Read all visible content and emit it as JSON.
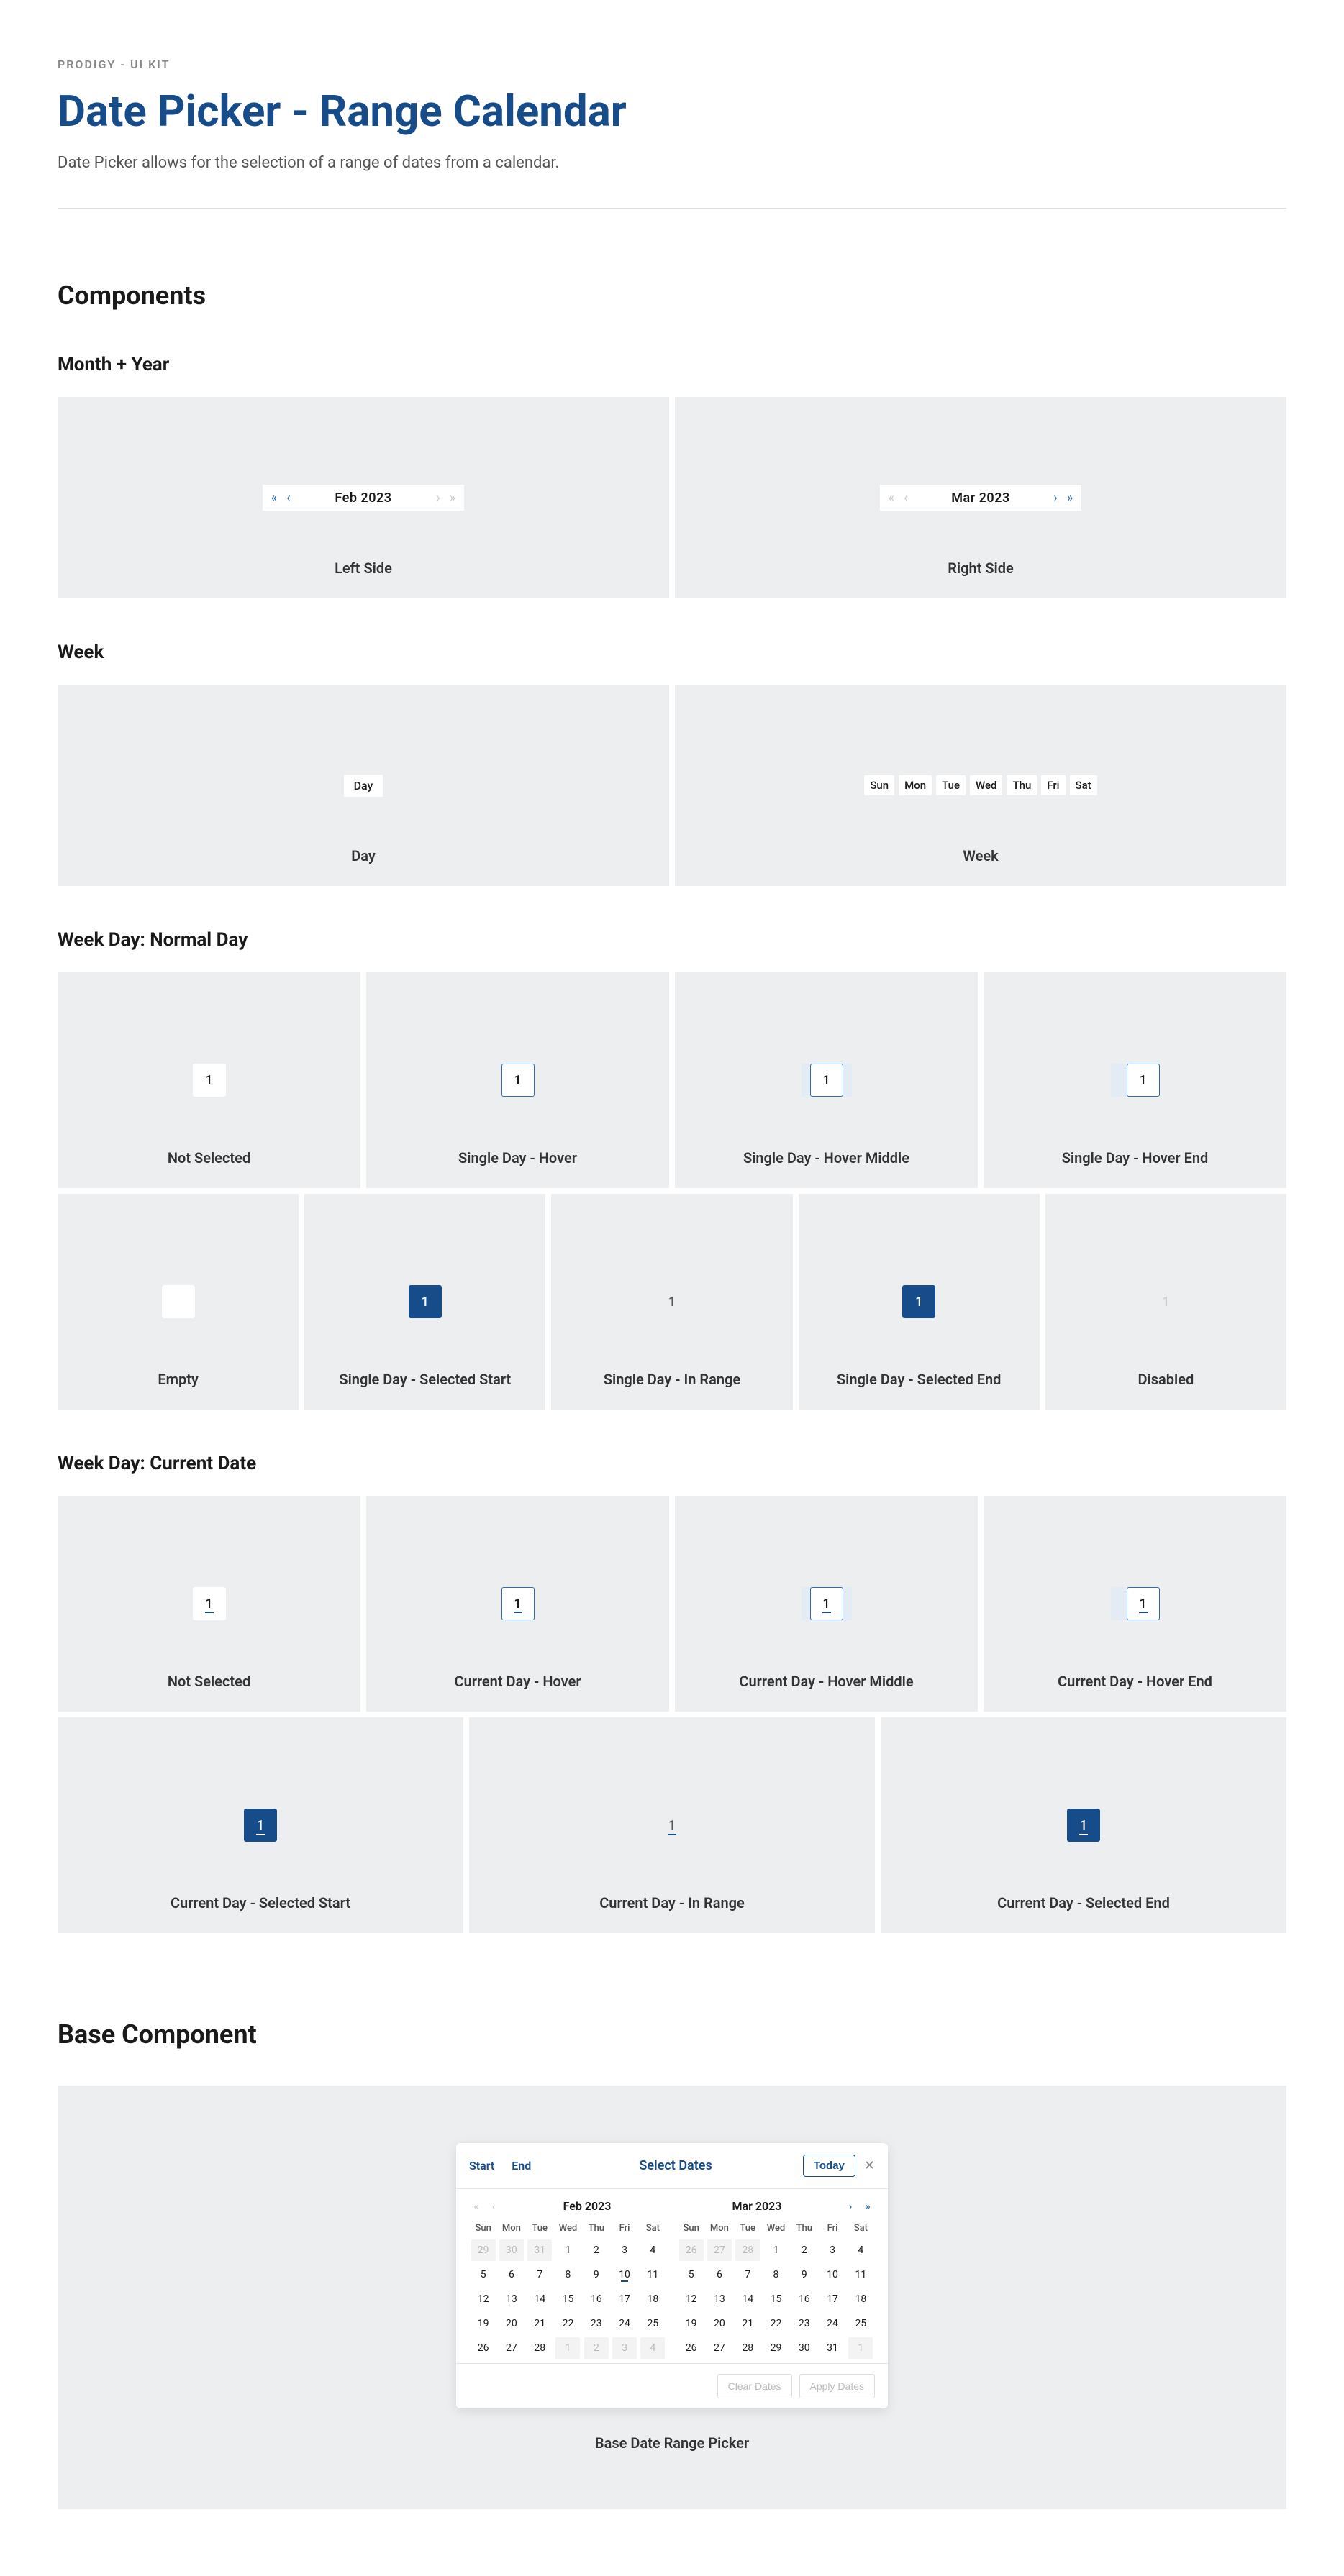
{
  "eyebrow": "PRODIGY - UI KIT",
  "title": "Date Picker - Range Calendar",
  "description": "Date Picker allows for the selection of a range of dates from a calendar.",
  "sections": {
    "components": "Components",
    "monthYear": "Month +  Year",
    "week": "Week",
    "normalDay": "Week Day: Normal Day",
    "currentDate": "Week Day: Current Date",
    "baseComponent": "Base Component"
  },
  "monthYear": {
    "left": {
      "label": "Feb 2023",
      "caption": "Left Side"
    },
    "right": {
      "label": "Mar 2023",
      "caption": "Right Side"
    }
  },
  "week": {
    "single": "Day",
    "singleCaption": "Day",
    "days": [
      "Sun",
      "Mon",
      "Tue",
      "Wed",
      "Thu",
      "Fri",
      "Sat"
    ],
    "weekCaption": "Week"
  },
  "normal": {
    "v": "1",
    "captions": {
      "notSelected": "Not Selected",
      "hover": "Single Day - Hover",
      "hoverMiddle": "Single Day - Hover Middle",
      "hoverEnd": "Single Day - Hover End",
      "empty": "Empty",
      "selStart": "Single Day - Selected Start",
      "inRange": "Single Day - In Range",
      "selEnd": "Single Day - Selected End",
      "disabled": "Disabled"
    }
  },
  "current": {
    "v": "1",
    "captions": {
      "notSelected": "Not Selected",
      "hover": "Current Day - Hover",
      "hoverMiddle": "Current Day - Hover Middle",
      "hoverEnd": "Current Day - Hover End",
      "selStart": "Current Day - Selected Start",
      "inRange": "Current Day - In Range",
      "selEnd": "Current Day - Selected End"
    }
  },
  "card": {
    "tabStart": "Start",
    "tabEnd": "End",
    "title": "Select Dates",
    "today": "Today",
    "monthLeft": "Feb 2023",
    "monthRight": "Mar 2023",
    "dow": [
      "Sun",
      "Mon",
      "Tue",
      "Wed",
      "Thu",
      "Fri",
      "Sat"
    ],
    "feb": [
      [
        {
          "n": "29",
          "m": true
        },
        {
          "n": "30",
          "m": true
        },
        {
          "n": "31",
          "m": true
        },
        {
          "n": "1"
        },
        {
          "n": "2"
        },
        {
          "n": "3"
        },
        {
          "n": "4"
        }
      ],
      [
        {
          "n": "5"
        },
        {
          "n": "6"
        },
        {
          "n": "7"
        },
        {
          "n": "8"
        },
        {
          "n": "9"
        },
        {
          "n": "10",
          "t": true
        },
        {
          "n": "11"
        }
      ],
      [
        {
          "n": "12"
        },
        {
          "n": "13"
        },
        {
          "n": "14"
        },
        {
          "n": "15"
        },
        {
          "n": "16"
        },
        {
          "n": "17"
        },
        {
          "n": "18"
        }
      ],
      [
        {
          "n": "19"
        },
        {
          "n": "20"
        },
        {
          "n": "21"
        },
        {
          "n": "22"
        },
        {
          "n": "23"
        },
        {
          "n": "24"
        },
        {
          "n": "25"
        }
      ],
      [
        {
          "n": "26"
        },
        {
          "n": "27"
        },
        {
          "n": "28"
        },
        {
          "n": "1",
          "m": true
        },
        {
          "n": "2",
          "m": true
        },
        {
          "n": "3",
          "m": true
        },
        {
          "n": "4",
          "m": true
        }
      ]
    ],
    "mar": [
      [
        {
          "n": "26",
          "m": true
        },
        {
          "n": "27",
          "m": true
        },
        {
          "n": "28",
          "m": true
        },
        {
          "n": "1"
        },
        {
          "n": "2"
        },
        {
          "n": "3"
        },
        {
          "n": "4"
        }
      ],
      [
        {
          "n": "5"
        },
        {
          "n": "6"
        },
        {
          "n": "7"
        },
        {
          "n": "8"
        },
        {
          "n": "9"
        },
        {
          "n": "10"
        },
        {
          "n": "11"
        }
      ],
      [
        {
          "n": "12"
        },
        {
          "n": "13"
        },
        {
          "n": "14"
        },
        {
          "n": "15"
        },
        {
          "n": "16"
        },
        {
          "n": "17"
        },
        {
          "n": "18"
        }
      ],
      [
        {
          "n": "19"
        },
        {
          "n": "20"
        },
        {
          "n": "21"
        },
        {
          "n": "22"
        },
        {
          "n": "23"
        },
        {
          "n": "24"
        },
        {
          "n": "25"
        }
      ],
      [
        {
          "n": "26"
        },
        {
          "n": "27"
        },
        {
          "n": "28"
        },
        {
          "n": "29"
        },
        {
          "n": "30"
        },
        {
          "n": "31"
        },
        {
          "n": "1",
          "m": true
        }
      ]
    ],
    "clear": "Clear Dates",
    "apply": "Apply Dates",
    "caption": "Base Date Range Picker"
  }
}
